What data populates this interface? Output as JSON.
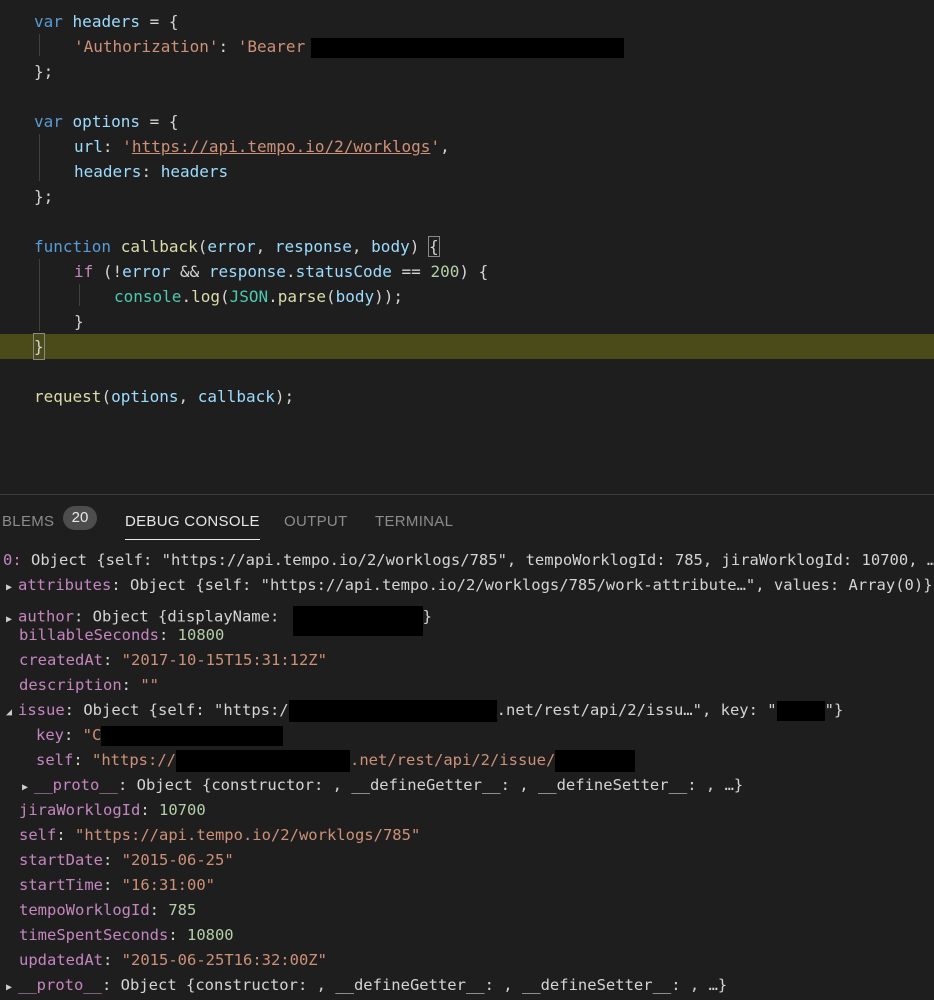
{
  "code": {
    "l1": {
      "kw": "var",
      "name": "headers",
      "rest": " = {"
    },
    "l2": {
      "key": "'Authorization'",
      "colon": ": ",
      "val": "'Bearer "
    },
    "l3": {
      "text": "};"
    },
    "l5": {
      "kw": "var",
      "name": "options",
      "rest": " = {"
    },
    "l6": {
      "key": "url",
      "colon": ": ",
      "q1": "'",
      "url": "https://api.tempo.io/2/worklogs",
      "q2": "'",
      "comma": ","
    },
    "l7": {
      "key": "headers",
      "colon": ": ",
      "val": "headers"
    },
    "l8": {
      "text": "};"
    },
    "l10": {
      "kw": "function",
      "name": "callback",
      "p1": "(",
      "a1": "error",
      ", ": ", ",
      "a2": "response",
      "a3": "body",
      "close": ") ",
      "brace": "{"
    },
    "l11": {
      "kw": "if",
      "open": " (!",
      "a1": "error",
      "and": " && ",
      "obj": "response",
      "dot": ".",
      "prop": "statusCode",
      "eq": " == ",
      "num": "200",
      "close": ") {"
    },
    "l12": {
      "obj": "console",
      "dot": ".",
      "fn": "log",
      "p": "(",
      "cls": "JSON",
      "dot2": ".",
      "fn2": "parse",
      "p2": "(",
      "arg": "body",
      "end": "));"
    },
    "l13": {
      "text": "}"
    },
    "l14": {
      "text": "}"
    },
    "l16": {
      "fn": "request",
      "p": "(",
      "a1": "options",
      "sep": ", ",
      "a2": "callback",
      "end": ");"
    }
  },
  "tabs": {
    "problems": "BLEMS",
    "problems_count": "20",
    "debug": "DEBUG CONSOLE",
    "output": "OUTPUT",
    "terminal": "TERMINAL"
  },
  "console": {
    "r0": {
      "prefix": "0: ",
      "text": "Object {self: \"https://api.tempo.io/2/worklogs/785\", tempoWorklogId: 785, jiraWorklogId: 10700, …}"
    },
    "r1": {
      "key": "attributes",
      "text": "Object {self: \"https://api.tempo.io/2/worklogs/785/work-attribute…\", values: Array(0)}"
    },
    "r2": {
      "key": "author",
      "text": "Object {displayName: ",
      "end": "}"
    },
    "r3": {
      "key": "billableSeconds",
      "val": "10800"
    },
    "r4": {
      "key": "createdAt",
      "val": "\"2017-10-15T15:31:12Z\""
    },
    "r5": {
      "key": "description",
      "val": "\"\""
    },
    "r6": {
      "key": "issue",
      "t1": "Object {self: \"https:/",
      "t2": ".net/rest/api/2/issu…\", key: \"",
      "t3": "\"}"
    },
    "r7": {
      "key": "key",
      "val": "\"C"
    },
    "r8": {
      "key": "self",
      "v1": "\"https://",
      "v2": ".net/rest/api/2/issue/"
    },
    "r9": {
      "key": "__proto__",
      "text": "Object {constructor: , __defineGetter__: , __defineSetter__: , …}"
    },
    "r10": {
      "key": "jiraWorklogId",
      "val": "10700"
    },
    "r11": {
      "key": "self",
      "val": "\"https://api.tempo.io/2/worklogs/785\""
    },
    "r12": {
      "key": "startDate",
      "val": "\"2015-06-25\""
    },
    "r13": {
      "key": "startTime",
      "val": "\"16:31:00\""
    },
    "r14": {
      "key": "tempoWorklogId",
      "val": "785"
    },
    "r15": {
      "key": "timeSpentSeconds",
      "val": "10800"
    },
    "r16": {
      "key": "updatedAt",
      "val": "\"2015-06-25T16:32:00Z\""
    },
    "r17": {
      "key": "__proto__",
      "text": "Object {constructor: , __defineGetter__: , __defineSetter__: , …}"
    }
  },
  "colors": {
    "background": "#1e1e1e",
    "keyword": "#569cd6",
    "string": "#ce9178",
    "number": "#b5cea8",
    "property": "#9cdcfe",
    "function": "#dcdcaa",
    "console_key": "#c586c0",
    "line_highlight": "#4b4b1a"
  }
}
